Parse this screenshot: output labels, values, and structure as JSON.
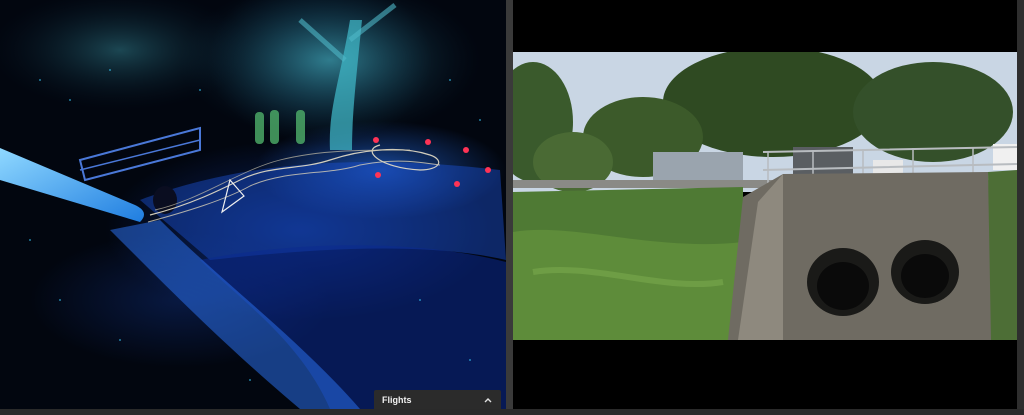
{
  "flights_panel": {
    "title": "Flights"
  },
  "icons": {
    "flights_toggle": "chevron-up-icon"
  },
  "colors": {
    "divider": "#3a3a3a",
    "panel_bg": "#2b2b2b",
    "cloud_accent": "#2f7bff"
  }
}
